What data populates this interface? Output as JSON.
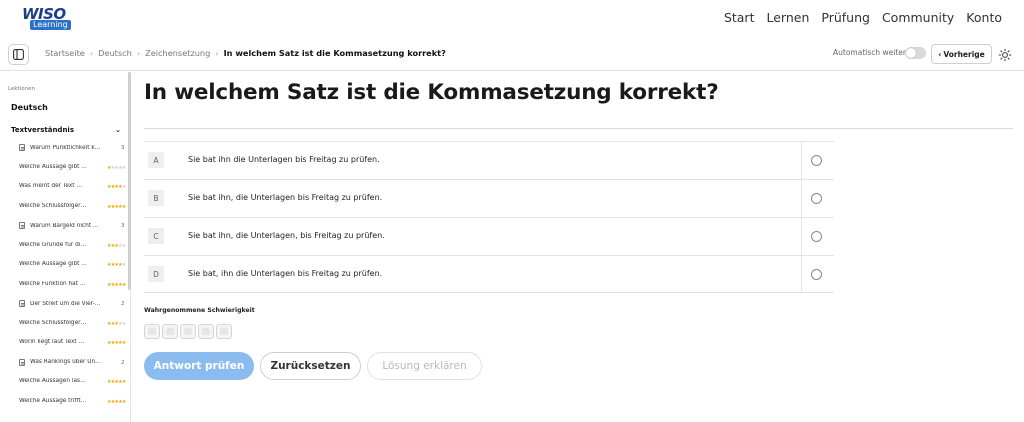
{
  "logo": {
    "main": "WISO",
    "sub": "Learning"
  },
  "nav": [
    "Start",
    "Lernen",
    "Prüfung",
    "Community",
    "Konto"
  ],
  "breadcrumb": {
    "items": [
      "Startseite",
      "Deutsch",
      "Zeichensetzung"
    ],
    "separator": "›",
    "current": "In welchem Satz ist die Kommasetzung korrekt?"
  },
  "toolbar": {
    "auto_next_label": "Automatisch weiter",
    "auto_next_enabled": false,
    "prev_label": "Vorherige",
    "prev_arrow": "‹"
  },
  "sidebar": {
    "section_label": "Lektionen",
    "course": "Deutsch",
    "group": {
      "label": "Textverständnis",
      "chevron": "⌄"
    },
    "items": [
      {
        "type": "lesson",
        "label": "Warum Pünktlichkeit k…",
        "count": "3"
      },
      {
        "type": "exercise",
        "label": "Welche Aussage gibt …",
        "stars": 1
      },
      {
        "type": "exercise",
        "label": "Was meint der Text …",
        "stars": 4
      },
      {
        "type": "exercise",
        "label": "Welche Schlussfolger…",
        "stars": 5
      },
      {
        "type": "lesson",
        "label": "Warum Bargeld nicht …",
        "count": "3"
      },
      {
        "type": "exercise",
        "label": "Welche Gründe für di…",
        "stars": 3
      },
      {
        "type": "exercise",
        "label": "Welche Aussage gibt …",
        "stars": 4
      },
      {
        "type": "exercise",
        "label": "Welche Funktion hat …",
        "stars": 5
      },
      {
        "type": "lesson",
        "label": "Der Streit um die Vier-…",
        "count": "2"
      },
      {
        "type": "exercise",
        "label": "Welche Schlussfolger…",
        "stars": 3
      },
      {
        "type": "exercise",
        "label": "Worin liegt laut Text …",
        "stars": 5
      },
      {
        "type": "lesson",
        "label": "Was Rankings über Un…",
        "count": "2"
      },
      {
        "type": "exercise",
        "label": "Welche Aussagen las…",
        "stars": 5
      },
      {
        "type": "exercise",
        "label": "Welche Aussage trifft…",
        "stars": 5
      }
    ]
  },
  "question": {
    "title": "In welchem Satz ist die Kommasetzung korrekt?",
    "answers": [
      {
        "letter": "A",
        "text": "Sie bat ihn die Unterlagen bis Freitag zu prüfen."
      },
      {
        "letter": "B",
        "text": "Sie bat ihn, die Unterlagen bis Freitag zu prüfen."
      },
      {
        "letter": "C",
        "text": "Sie bat ihn, die Unterlagen, bis Freitag zu prüfen."
      },
      {
        "letter": "D",
        "text": "Sie bat, ihn die Unterlagen bis Freitag zu prüfen."
      }
    ]
  },
  "difficulty": {
    "label": "Wahrgenommene Schwierigkeit",
    "levels": 5
  },
  "actions": {
    "check": "Antwort prüfen",
    "reset": "Zurücksetzen",
    "explain": "Lösung erklären"
  },
  "colors": {
    "primary_button": "#8bbcef",
    "star_filled": "#f0a500",
    "star_empty": "#cfcfcf",
    "logo_blue": "#1b3f8a"
  }
}
